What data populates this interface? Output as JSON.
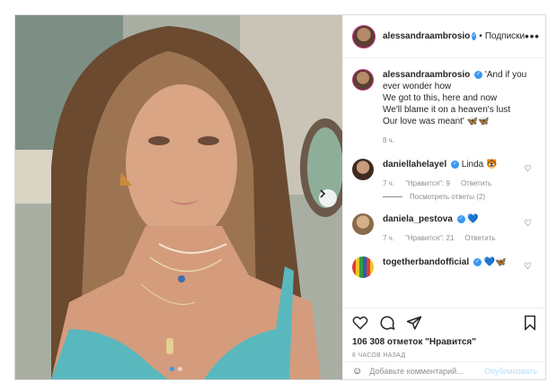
{
  "post": {
    "username": "alessandraambrosio",
    "follow_label": "Подписки",
    "more_label": "•••",
    "carousel": {
      "active_index": 0,
      "count": 2
    }
  },
  "caption": {
    "username": "alessandraambrosio",
    "lines": [
      "'And if you",
      "ever wonder how",
      "We got to this, here and now",
      "We'll blame it on a heaven's lust",
      "Our love was meant' 🦋🦋"
    ],
    "time": "8 ч."
  },
  "comments": [
    {
      "username": "daniellahelayel",
      "text": "Linda 🐯",
      "time": "7 ч.",
      "likes": "\"Нравится\": 9",
      "reply": "Ответить"
    },
    {
      "username": "daniela_pestova",
      "text": "💙",
      "time": "7 ч.",
      "likes": "\"Нравится\": 21",
      "reply": "Ответить"
    },
    {
      "username": "togetherbandofficial",
      "text": "💙🦋",
      "time": "",
      "likes": "",
      "reply": ""
    }
  ],
  "view_replies": "Посмотреть ответы (2)",
  "likes_text": "106 308 отметок \"Нравится\"",
  "time_ago": "8 ЧАСОВ НАЗАД",
  "add_comment": {
    "placeholder": "Добавьте комментарий...",
    "post_label": "Опубликовать"
  },
  "icons": [
    "heart-icon",
    "comment-icon",
    "share-icon",
    "bookmark-icon",
    "emoji-icon",
    "chevron-right-icon"
  ],
  "colors": {
    "verified": "#3897f0",
    "post_disabled": "#b2dffc",
    "border": "#dbdbdb",
    "meta": "#8e8e8e"
  }
}
